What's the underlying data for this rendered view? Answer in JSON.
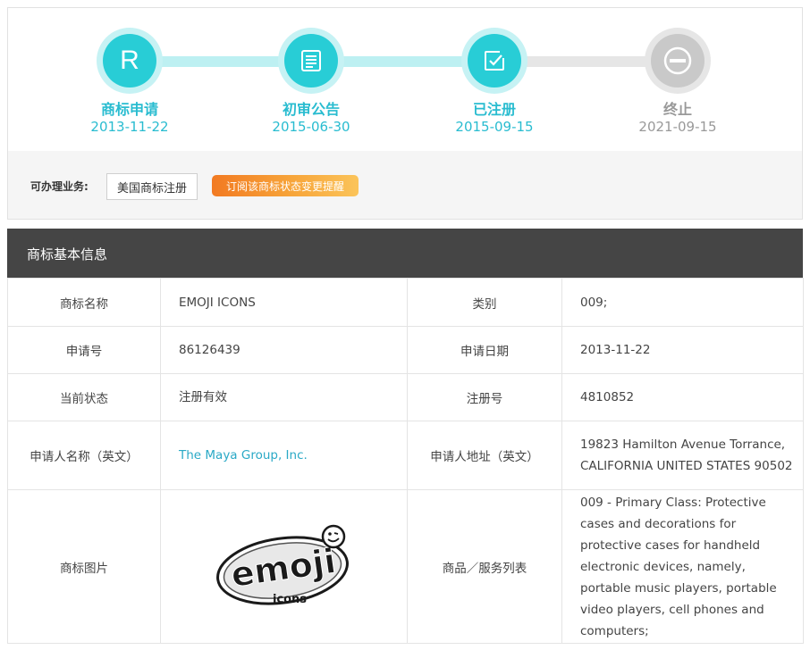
{
  "timeline": {
    "steps": [
      {
        "label": "商标申请",
        "date": "2013-11-22",
        "status": "active",
        "icon": "r-letter-icon",
        "letter": "R"
      },
      {
        "label": "初审公告",
        "date": "2015-06-30",
        "status": "active",
        "icon": "document-icon"
      },
      {
        "label": "已注册",
        "date": "2015-09-15",
        "status": "active",
        "icon": "check-edit-icon"
      },
      {
        "label": "终止",
        "date": "2021-09-15",
        "status": "inactive",
        "icon": "minus-circle-icon"
      }
    ],
    "colors": {
      "active": "#28cdd6",
      "active_text": "#29bcd0",
      "inactive": "#c9c9c9"
    }
  },
  "business": {
    "label": "可办理业务:",
    "button_label": "美国商标注册",
    "subscribe_label": "订阅该商标状态变更提醒"
  },
  "info": {
    "title": "商标基本信息",
    "rows": [
      {
        "k1": "商标名称",
        "v1": "EMOJI ICONS",
        "k2": "类别",
        "v2": "009;"
      },
      {
        "k1": "申请号",
        "v1": "86126439",
        "k2": "申请日期",
        "v2": "2013-11-22"
      },
      {
        "k1": "当前状态",
        "v1": "注册有效",
        "k2": "注册号",
        "v2": "4810852"
      },
      {
        "k1": "申请人名称（英文）",
        "v1": "The Maya Group, Inc.",
        "k2": "申请人地址（英文）",
        "v2": "19823 Hamilton Avenue Torrance, CALIFORNIA UNITED STATES 90502"
      },
      {
        "k1": "商标图片",
        "logo_text": "emoji",
        "logo_sub": "icons",
        "k2": "商品／服务列表",
        "v2": "009 - Primary Class: Protective cases and decorations for protective cases for handheld electronic devices, namely, portable music players, portable video players, cell phones and computers;"
      }
    ]
  }
}
